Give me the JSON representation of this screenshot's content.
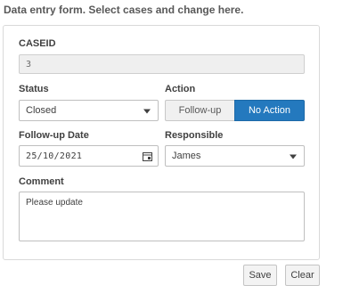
{
  "header": {
    "title": "Data entry form. Select cases and change here."
  },
  "form": {
    "caseid": {
      "label": "CASEID",
      "value": "3"
    },
    "status": {
      "label": "Status",
      "value": "Closed"
    },
    "action": {
      "label": "Action",
      "options": [
        "Follow-up",
        "No Action"
      ],
      "selected": "No Action"
    },
    "followup_date": {
      "label": "Follow-up Date",
      "value": "25/10/2021"
    },
    "responsible": {
      "label": "Responsible",
      "value": "James"
    },
    "comment": {
      "label": "Comment",
      "value": "Please update"
    }
  },
  "buttons": {
    "save": "Save",
    "clear": "Clear"
  },
  "colors": {
    "accent": "#2479be",
    "panel_border": "#d9d9d9"
  }
}
